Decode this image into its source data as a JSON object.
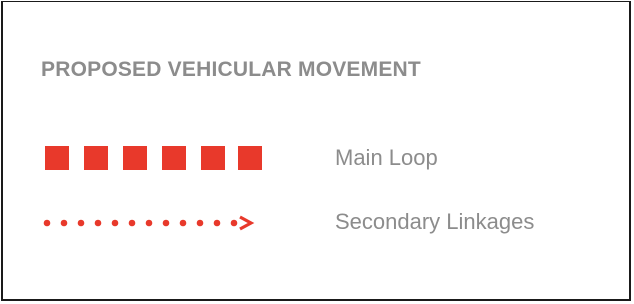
{
  "legend": {
    "title": "PROPOSED VEHICULAR MOVEMENT",
    "accent_color": "#e8392b",
    "text_color": "#8c8c8c",
    "items": [
      {
        "label": "Main Loop",
        "symbol": "square-dash-line"
      },
      {
        "label": "Secondary Linkages",
        "symbol": "dotted-arrow-line"
      }
    ]
  }
}
